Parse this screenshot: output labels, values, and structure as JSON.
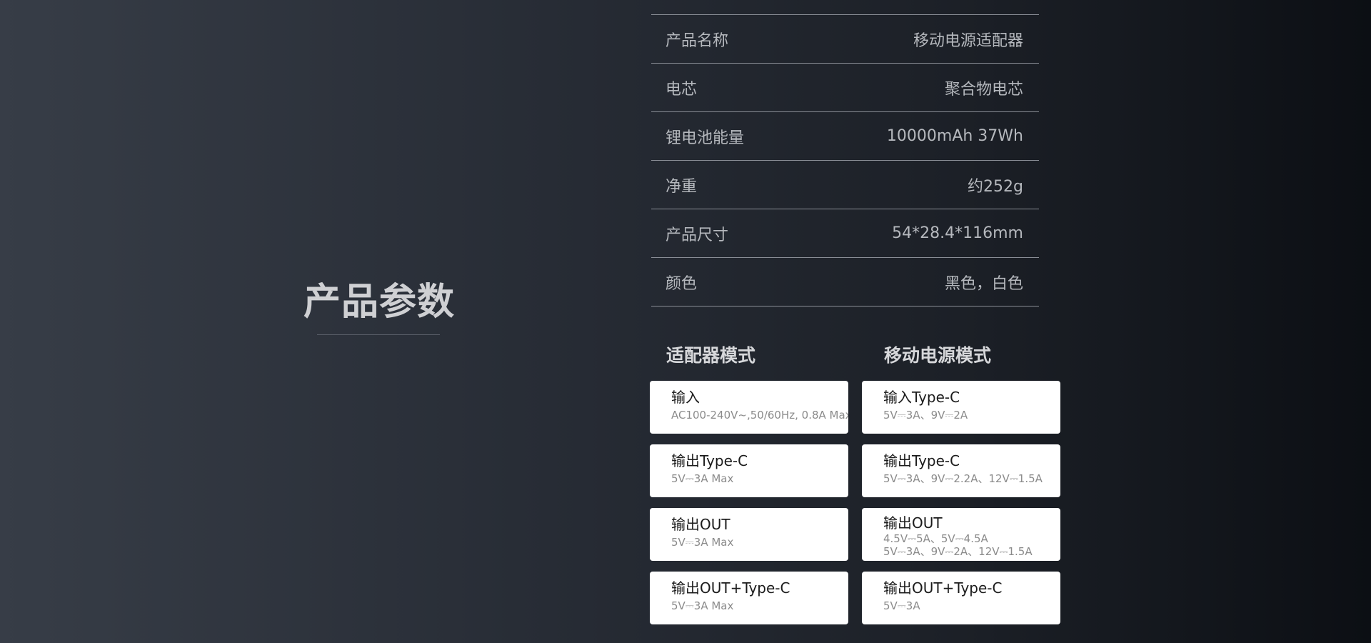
{
  "section": {
    "title": "产品参数"
  },
  "specs": [
    {
      "label": "产品名称",
      "value": "移动电源适配器"
    },
    {
      "label": "电芯",
      "value": "聚合物电芯"
    },
    {
      "label": "锂电池能量",
      "value": "10000mAh 37Wh"
    },
    {
      "label": "净重",
      "value": "约252g"
    },
    {
      "label": "产品尺寸",
      "value": "54*28.4*116mm"
    },
    {
      "label": "颜色",
      "value": "黑色，白色"
    }
  ],
  "adapter_mode": {
    "title": "适配器模式",
    "cards": [
      {
        "label": "输入",
        "value": "AC100-240V~,50/60Hz, 0.8A Max"
      },
      {
        "label": "输出Type-C",
        "value": "5V⎓3A Max"
      },
      {
        "label": "输出OUT",
        "value": "5V⎓3A Max"
      },
      {
        "label": "输出OUT+Type-C",
        "value": "5V⎓3A Max"
      }
    ]
  },
  "power_bank_mode": {
    "title": "移动电源模式",
    "cards": [
      {
        "label": "输入Type-C",
        "value": "5V⎓3A、9V⎓2A"
      },
      {
        "label": "输出Type-C",
        "value": "5V⎓3A、9V⎓2.2A、12V⎓1.5A"
      },
      {
        "label": "输出OUT",
        "value": "4.5V⎓5A、5V⎓4.5A",
        "value2": "5V⎓3A、9V⎓2A、12V⎓1.5A"
      },
      {
        "label": "输出OUT+Type-C",
        "value": "5V⎓3A"
      }
    ]
  }
}
